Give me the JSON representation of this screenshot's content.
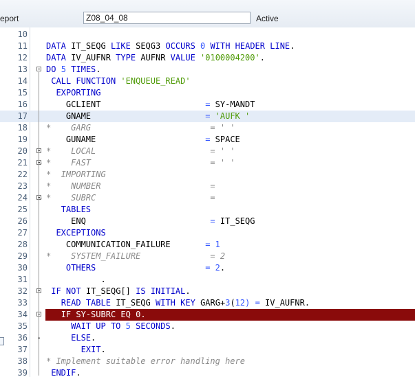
{
  "header": {
    "report_label": "eport",
    "program_name": "Z08_04_08",
    "status": "Active"
  },
  "editor": {
    "lines": [
      {
        "n": "10",
        "text": ""
      },
      {
        "n": "11",
        "text": "DATA IT_SEQG LIKE SEQG3 OCCURS 0 WITH HEADER LINE."
      },
      {
        "n": "12",
        "text": "DATA IV_AUFNR TYPE AUFNR VALUE '0100004200'."
      },
      {
        "n": "13",
        "text": "DO 5 TIMES."
      },
      {
        "n": "14",
        "text": " CALL FUNCTION 'ENQUEUE_READ'"
      },
      {
        "n": "15",
        "text": "  EXPORTING"
      },
      {
        "n": "16",
        "text": "    GCLIENT                     = SY-MANDT"
      },
      {
        "n": "17",
        "text": "    GNAME                       = 'AUFK '"
      },
      {
        "n": "18",
        "text": "*    GARG                        = ' '"
      },
      {
        "n": "19",
        "text": "    GUNAME                      = SPACE"
      },
      {
        "n": "20",
        "text": "*    LOCAL                       = ' '"
      },
      {
        "n": "21",
        "text": "*    FAST                        = ' '"
      },
      {
        "n": "22",
        "text": "*  IMPORTING"
      },
      {
        "n": "23",
        "text": "*    NUMBER                      ="
      },
      {
        "n": "24",
        "text": "*    SUBRC                       ="
      },
      {
        "n": "25",
        "text": "   TABLES"
      },
      {
        "n": "26",
        "text": "     ENQ                         = IT_SEQG"
      },
      {
        "n": "27",
        "text": "  EXCEPTIONS"
      },
      {
        "n": "28",
        "text": "    COMMUNICATION_FAILURE       = 1"
      },
      {
        "n": "29",
        "text": "*    SYSTEM_FAILURE              = 2"
      },
      {
        "n": "30",
        "text": "    OTHERS                      = 2."
      },
      {
        "n": "31",
        "text": "           ."
      },
      {
        "n": "32",
        "text": " IF NOT IT_SEQG[] IS INITIAL."
      },
      {
        "n": "33",
        "text": "   READ TABLE IT_SEQG WITH KEY GARG+3(12) = IV_AUFNR."
      },
      {
        "n": "34",
        "text": "   IF SY-SUBRC EQ 0."
      },
      {
        "n": "35",
        "text": "     WAIT UP TO 5 SECONDS."
      },
      {
        "n": "36",
        "text": "     ELSE."
      },
      {
        "n": "37",
        "text": "       EXIT."
      },
      {
        "n": "38",
        "text": "* Implement suitable error handling here"
      },
      {
        "n": "39",
        "text": " ENDIF."
      }
    ]
  },
  "colors": {
    "keyword": "#0000cc",
    "string": "#4e9a06",
    "number": "#3355ff",
    "comment": "#8a8a8a",
    "error_highlight": "#8a0b0b",
    "current_line": "#e4ecf7"
  }
}
